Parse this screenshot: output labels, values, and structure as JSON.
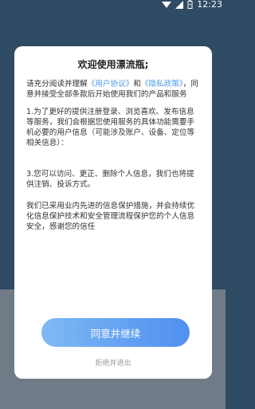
{
  "status_bar": {
    "time": "12:23"
  },
  "dialog": {
    "title": "欢迎使用漂流瓶;",
    "intro_part1": "请充分阅读并理解",
    "link_user_agreement": "《用户协议》",
    "intro_and": "和",
    "link_privacy": "《隐私政策》",
    "intro_part2": "，同意并接受全部条款后开始使用我们的产品和服务",
    "section1": "1.为了更好的提供注册登录、浏览喜欢、发布信息等服务，我们会根据您使用服务的具体功能需要手机必要的用户信息（可能涉及账户、设备、定位等相关信息）：",
    "section3": "3.您可以访问、更正、删除个人信息，我们也将提供注销、投诉方式。",
    "closing": "我们已采用业内先进的信息保护措施，并会持续优化信息保护技术和安全管理流程保护您的个人信息安全，感谢您的信任",
    "agree_button": "同意并继续",
    "reject_link": "拒绝并退出"
  },
  "colors": {
    "background_top": "#2f4a63",
    "background_bottom": "#6f7c87",
    "link": "#4a9be8",
    "button_gradient_start": "#7fb9f4",
    "button_gradient_end": "#4f8ff0"
  },
  "icons": [
    "wifi-icon",
    "signal-icon",
    "battery-icon"
  ]
}
